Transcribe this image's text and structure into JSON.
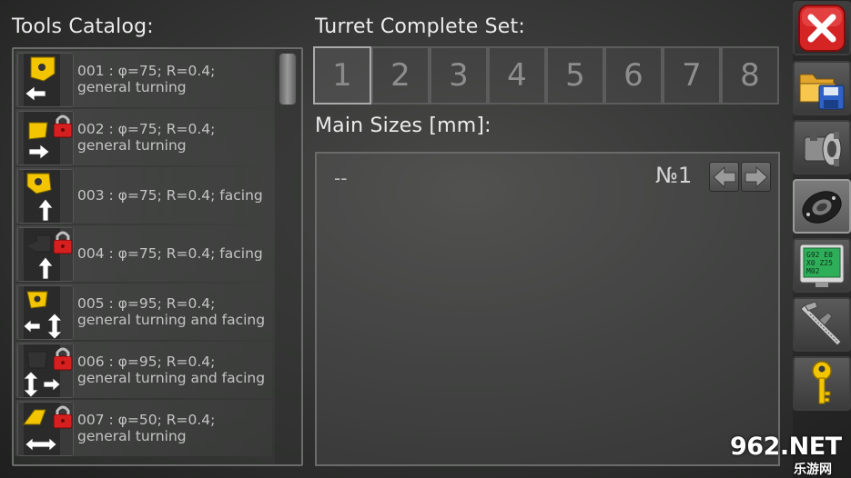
{
  "headings": {
    "catalog": "Tools Catalog:",
    "turret": "Turret Complete Set:",
    "sizes": "Main Sizes [mm]:"
  },
  "tools": [
    {
      "line1": "001 : φ=75; R=0.4;",
      "line2": "general turning",
      "locked": false,
      "icon": "turning-insert-left-arrow-icon"
    },
    {
      "line1": "002 : φ=75; R=0.4;",
      "line2": "general turning",
      "locked": true,
      "icon": "turning-insert-right-arrow-locked-icon"
    },
    {
      "line1": "003 : φ=75; R=0.4; facing",
      "line2": "",
      "locked": false,
      "icon": "facing-insert-up-arrow-icon"
    },
    {
      "line1": "004 : φ=75; R=0.4; facing",
      "line2": "",
      "locked": true,
      "icon": "facing-insert-up-arrow-locked-icon"
    },
    {
      "line1": "005 : φ=95; R=0.4;",
      "line2": "general turning and facing",
      "locked": false,
      "icon": "turning-facing-insert-icon"
    },
    {
      "line1": "006 : φ=95; R=0.4;",
      "line2": "general turning and facing",
      "locked": true,
      "icon": "turning-facing-insert-locked-icon"
    },
    {
      "line1": "007 : φ=50; R=0.4;",
      "line2": "general turning",
      "locked": true,
      "icon": "turning-insert-double-arrow-locked-icon"
    }
  ],
  "turret_tabs": [
    "1",
    "2",
    "3",
    "4",
    "5",
    "6",
    "7",
    "8"
  ],
  "turret_active_index": 0,
  "sizes": {
    "value": "--",
    "number_label": "№1"
  },
  "sidebar_icons": [
    "close-icon",
    "open-save-file-icon",
    "lathe-chuck-icon",
    "tool-holder-ring-icon",
    "cnc-program-screen-icon",
    "caliper-icon",
    "key-icon"
  ],
  "sidebar_program_text": [
    "G92 E0",
    "X0 Z25",
    "M02"
  ],
  "watermark": {
    "text": "962.NET",
    "sub": "乐游网"
  },
  "colors": {
    "close_red": "#e02b2b",
    "lock_red": "#d81f1f",
    "insert_yellow": "#f2c500",
    "screen_green": "#2fae5a"
  }
}
